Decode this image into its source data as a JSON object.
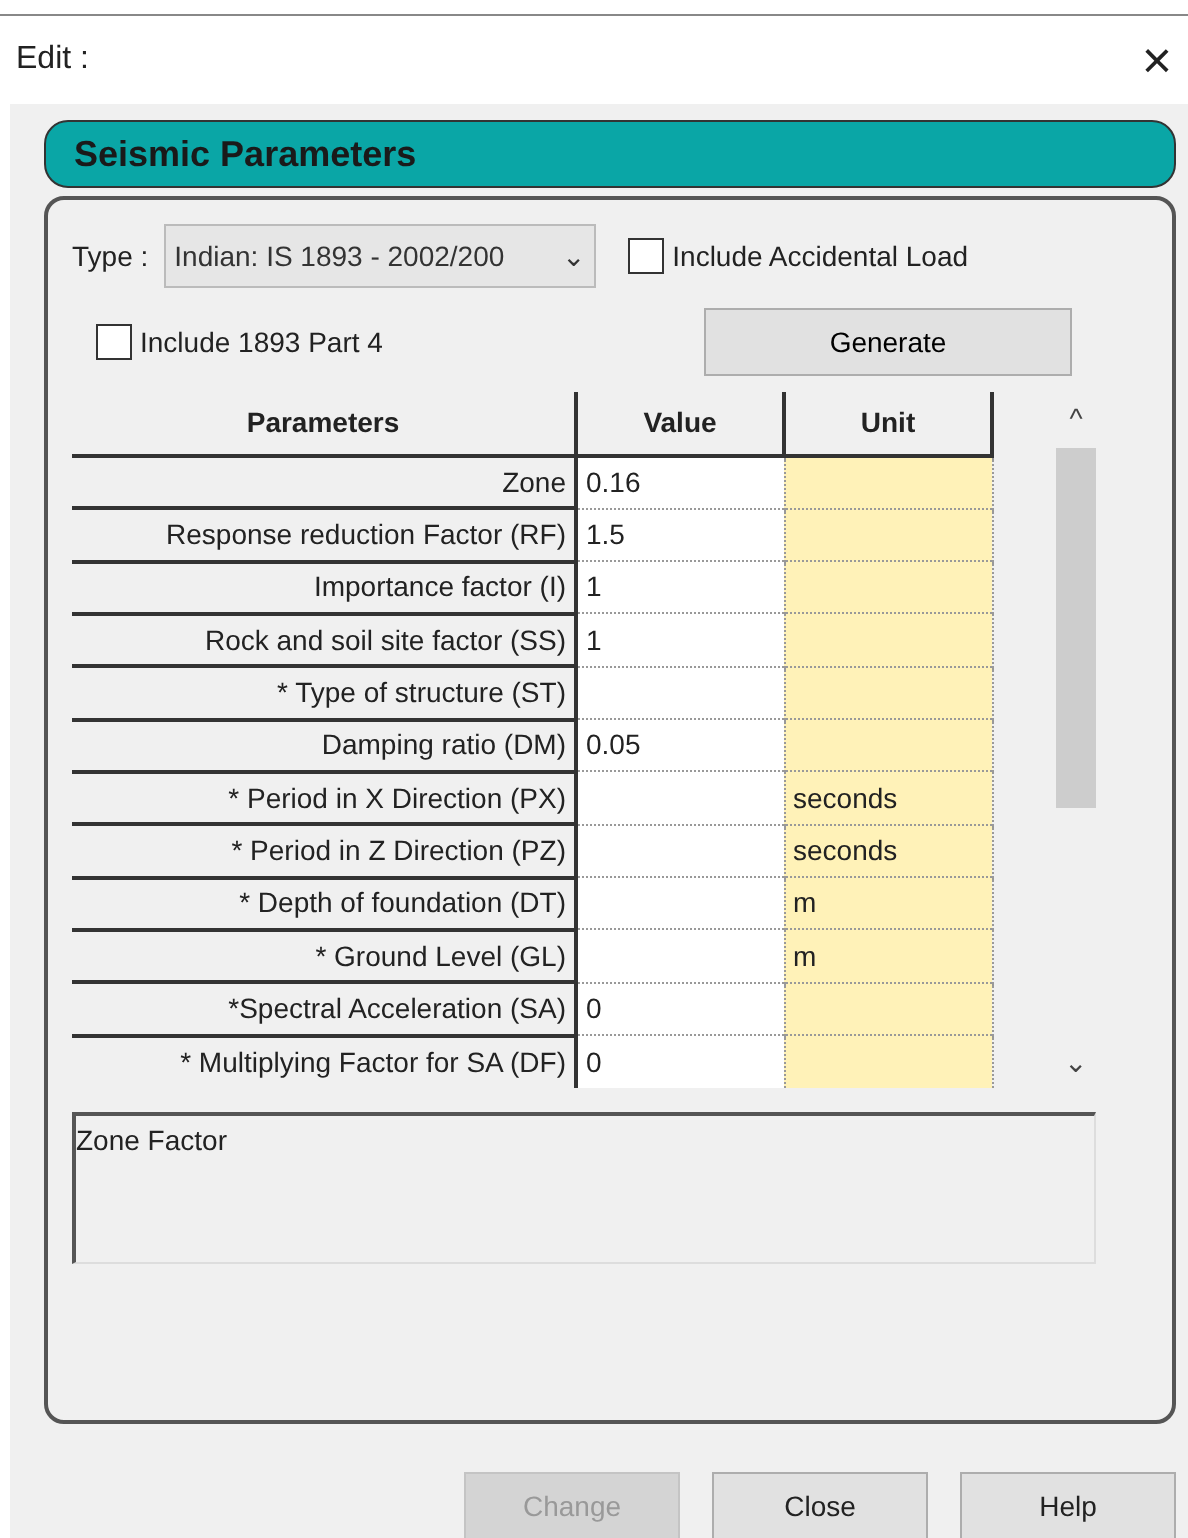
{
  "window": {
    "title": "Edit :",
    "close": "×"
  },
  "panel": {
    "title": "Seismic Parameters"
  },
  "type_field": {
    "label": "Type :",
    "value": "Indian: IS 1893 - 2002/200",
    "caret": "⌄"
  },
  "checkboxes": [
    {
      "label": "Include Accidental Load",
      "checked": false
    },
    {
      "label": "Include 1893 Part 4",
      "checked": false
    }
  ],
  "generate_button": {
    "label": "Generate"
  },
  "table": {
    "columns": [
      "Parameters",
      "Value",
      "Unit"
    ],
    "rows": [
      {
        "parameter": "Zone",
        "value": "0.16",
        "unit": ""
      },
      {
        "parameter": "Response reduction Factor (RF)",
        "value": "1.5",
        "unit": ""
      },
      {
        "parameter": "Importance factor (I)",
        "value": "1",
        "unit": ""
      },
      {
        "parameter": "Rock and soil site factor (SS)",
        "value": "1",
        "unit": ""
      },
      {
        "parameter": "* Type of structure (ST)",
        "value": "",
        "unit": ""
      },
      {
        "parameter": "Damping ratio (DM)",
        "value": "0.05",
        "unit": ""
      },
      {
        "parameter": "* Period in X Direction (PX)",
        "value": "",
        "unit": "seconds"
      },
      {
        "parameter": "* Period in Z Direction (PZ)",
        "value": "",
        "unit": "seconds"
      },
      {
        "parameter": "* Depth of foundation (DT)",
        "value": "",
        "unit": "m"
      },
      {
        "parameter": "* Ground Level (GL)",
        "value": "",
        "unit": "m"
      },
      {
        "parameter": "*Spectral Acceleration (SA)",
        "value": "0",
        "unit": ""
      },
      {
        "parameter": "* Multiplying Factor for SA (DF)",
        "value": "0",
        "unit": ""
      }
    ],
    "scroll_up": "^",
    "scroll_down": "⌄"
  },
  "description": "Zone Factor",
  "buttons": [
    {
      "label": "Change",
      "disabled": true
    },
    {
      "label": "Close",
      "disabled": false
    },
    {
      "label": "Help",
      "disabled": false
    }
  ]
}
